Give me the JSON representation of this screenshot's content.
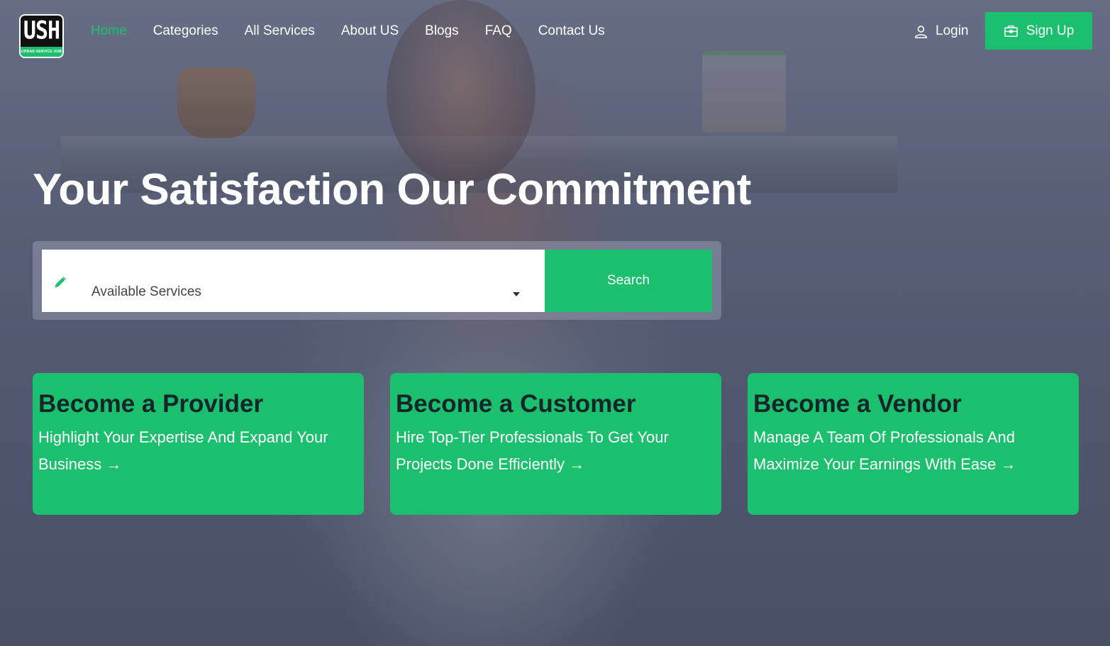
{
  "header": {
    "logo": {
      "text": "USH",
      "tagline": "URBAN SERVICE HUB"
    },
    "nav": [
      {
        "label": "Home",
        "active": true
      },
      {
        "label": "Categories",
        "active": false
      },
      {
        "label": "All Services",
        "active": false
      },
      {
        "label": "About US",
        "active": false
      },
      {
        "label": "Blogs",
        "active": false
      },
      {
        "label": "FAQ",
        "active": false
      },
      {
        "label": "Contact Us",
        "active": false
      }
    ],
    "login_label": "Login",
    "signup_label": "Sign Up"
  },
  "hero": {
    "title": "Your Satisfaction Our Commitment",
    "search": {
      "selected": "Available Services",
      "button_label": "Search"
    }
  },
  "cards": [
    {
      "title": "Become a Provider",
      "text": "Highlight Your Expertise And Expand Your Business →"
    },
    {
      "title": "Become a Customer",
      "text": "Hire Top-Tier Professionals To Get Your Projects Done Efficiently →"
    },
    {
      "title": "Become a Vendor",
      "text": "Manage A Team Of Professionals And Maximize Your Earnings With Ease →"
    }
  ],
  "colors": {
    "accent": "#1bbf6e",
    "card_title": "#12262a",
    "text_light": "#ffffff"
  },
  "icons": {
    "login": "user-icon",
    "signup": "briefcase-icon",
    "search_field": "pencil-icon",
    "dropdown": "caret-down-icon"
  }
}
